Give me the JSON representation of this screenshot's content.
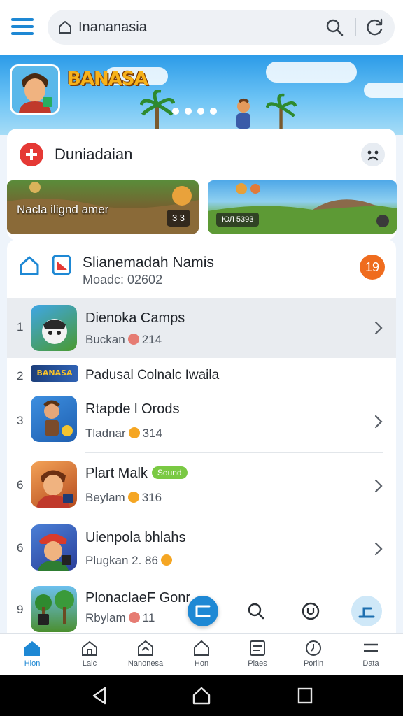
{
  "search": {
    "query": "Inananasia"
  },
  "hero": {
    "logo_text": "BANASA"
  },
  "card1": {
    "title": "Duniadaian",
    "promos": [
      {
        "label": "Nacla ilignd amer",
        "badge": "3 3"
      },
      {
        "label": "",
        "badge": "",
        "tag": "ЮЛ 5393"
      }
    ]
  },
  "list": {
    "header_title": "Slianemadah Namis",
    "header_subtitle": "Moadc: 02602",
    "header_badge": "19",
    "rows": [
      {
        "rank": "1",
        "name": "Dienoka Camps",
        "meta_prefix": "Buckan",
        "meta_value": "214"
      },
      {
        "rank": "2",
        "name": "Padusal Colnalc Iwaila",
        "wide_icon_text": "BANASA"
      },
      {
        "rank": "3",
        "name": "Rtapde l Orods",
        "meta_prefix": "Tladnar",
        "meta_value": "314"
      },
      {
        "rank": "6",
        "name": "Plart Malk",
        "new_tag": "Sound",
        "meta_prefix": "Beylam",
        "meta_value": "316"
      },
      {
        "rank": "6",
        "name": "Uienpola bhlahs",
        "meta_prefix": "Plugkan 2. 86",
        "meta_value": ""
      },
      {
        "rank": "9",
        "name": "PlonaclaeF Gonr",
        "meta_prefix": "Rbylam",
        "meta_value": "11"
      }
    ]
  },
  "bottom_nav": [
    {
      "label": "Hion",
      "icon": "home-icon",
      "active": true
    },
    {
      "label": "Laic",
      "icon": "house-outline-icon"
    },
    {
      "label": "Nanonesa",
      "icon": "store-icon"
    },
    {
      "label": "Hon",
      "icon": "house-icon"
    },
    {
      "label": "Plaes",
      "icon": "list-icon"
    },
    {
      "label": "Porlin",
      "icon": "clock-icon"
    },
    {
      "label": "Data",
      "icon": "menu-icon"
    }
  ],
  "colors": {
    "accent": "#1e88d4",
    "badge": "#ef6c1e",
    "highlight_row": "#e9ecf0"
  }
}
